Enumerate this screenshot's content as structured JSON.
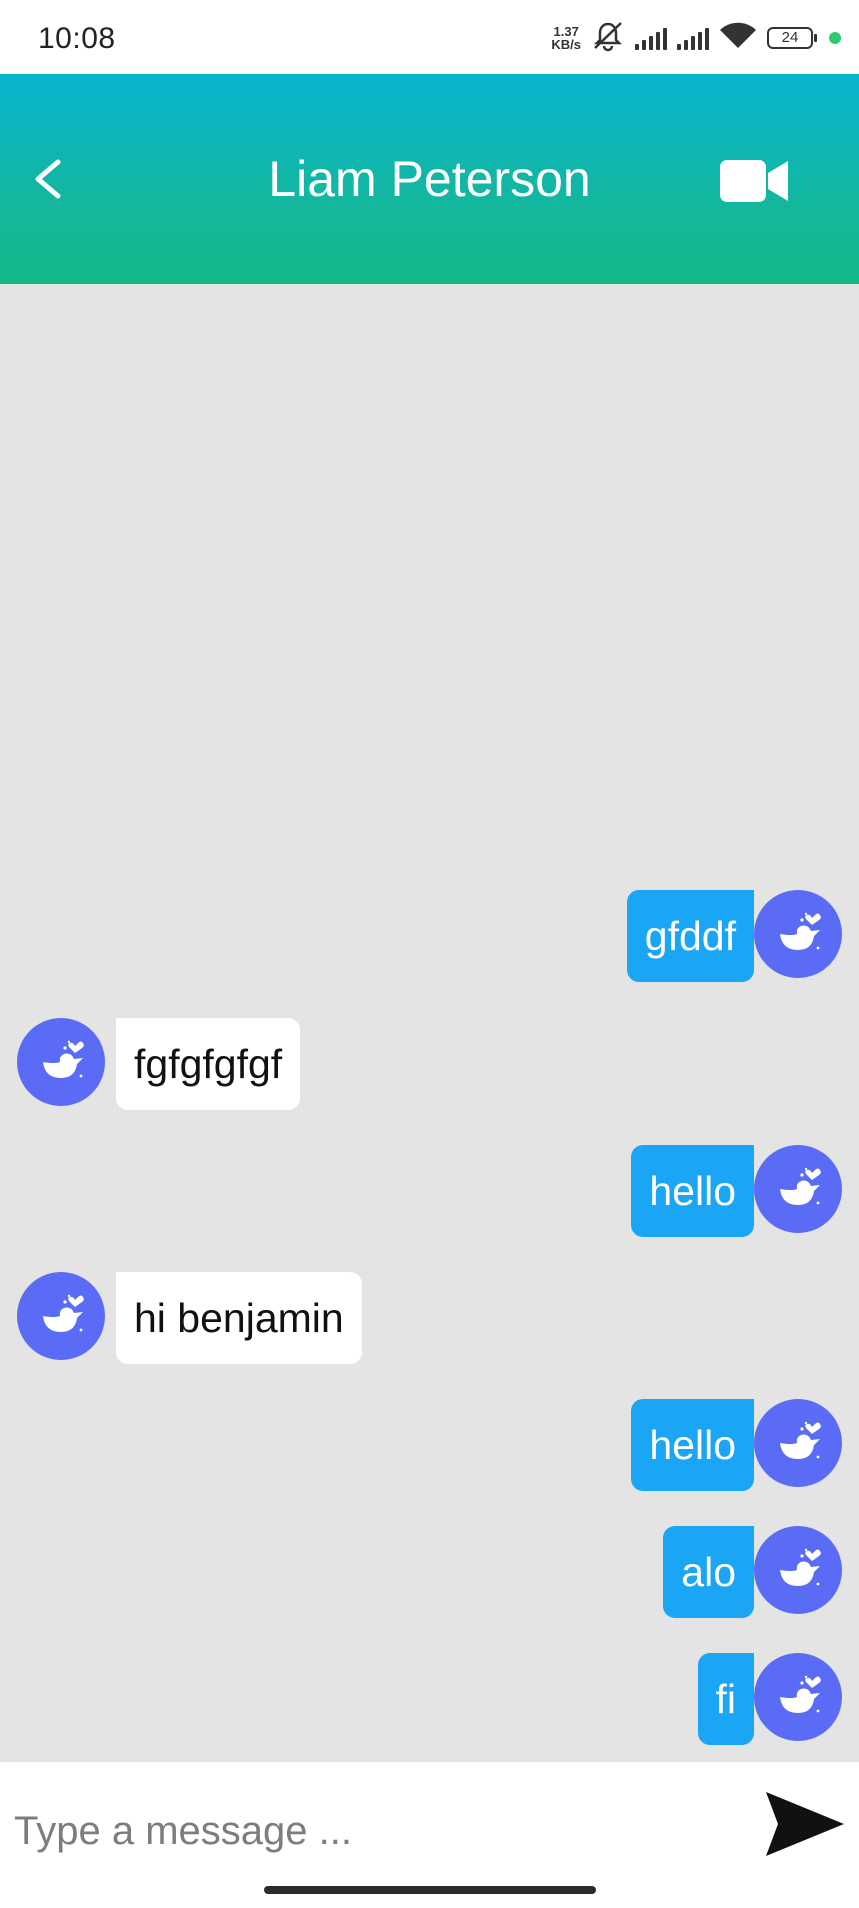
{
  "status_bar": {
    "time": "10:08",
    "net_speed_value": "1.37",
    "net_speed_unit": "KB/s",
    "battery_level": "24"
  },
  "header": {
    "title": "Liam Peterson",
    "back_icon": "chevron-left-icon",
    "video_icon": "video-camera-icon",
    "gradient_top": "#07b5d0",
    "gradient_bottom": "#12b986"
  },
  "messages": [
    {
      "direction": "outgoing",
      "text": "gfddf"
    },
    {
      "direction": "incoming",
      "text": "fgfgfgfgf"
    },
    {
      "direction": "outgoing",
      "text": "hello"
    },
    {
      "direction": "incoming",
      "text": "hi benjamin"
    },
    {
      "direction": "outgoing",
      "text": "hello"
    },
    {
      "direction": "outgoing",
      "text": "alo"
    },
    {
      "direction": "outgoing",
      "text": "fi"
    }
  ],
  "composer": {
    "placeholder": "Type a message ...",
    "value": "",
    "send_icon": "send-icon"
  },
  "colors": {
    "outgoing_bubble": "#1aa6f5",
    "incoming_bubble": "#ffffff",
    "avatar": "#5a6cf6",
    "chat_background": "#e4e4e4"
  }
}
